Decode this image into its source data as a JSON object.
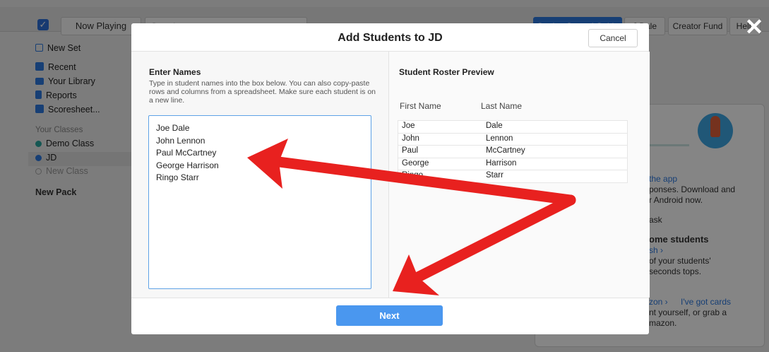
{
  "topbar": {
    "now_playing": "Now Playing",
    "search_placeholder": "Search",
    "guide": "Getting Started Guide",
    "user": "J Dale",
    "creator_fund": "Creator Fund",
    "help": "Help"
  },
  "sidebar": {
    "new_set": "New Set",
    "recent": "Recent",
    "library": "Your Library",
    "reports": "Reports",
    "scoresheet": "Scoresheet...",
    "classes_header": "Your Classes",
    "classes": [
      "Demo Class",
      "JD"
    ],
    "new_class": "New Class",
    "new_pack": "New Pack"
  },
  "background_card": {
    "link_app": "the app",
    "line1": "ponses. Download and",
    "line2": "r Android now.",
    "line3": "ask",
    "heading": "ome students",
    "link_sh": "sh ›",
    "line4": "of your students'",
    "line5": "seconds tops.",
    "link_amazon": "zon ›",
    "link_cards": "I've got cards",
    "line6": "nt yourself, or grab a",
    "line7": "mazon."
  },
  "modal": {
    "title": "Add Students to JD",
    "cancel": "Cancel",
    "enter_title": "Enter Names",
    "enter_help": "Type in student names into the box below. You can also copy-paste rows and columns from a spreadsheet. Make sure each student is on a new line.",
    "names": [
      "Joe Dale",
      "John Lennon",
      "Paul McCartney",
      "George Harrison",
      "Ringo Starr"
    ],
    "roster_title": "Student Roster Preview",
    "col_first": "First Name",
    "col_last": "Last Name",
    "roster": [
      {
        "first": "Joe",
        "last": "Dale"
      },
      {
        "first": "John",
        "last": "Lennon"
      },
      {
        "first": "Paul",
        "last": "McCartney"
      },
      {
        "first": "George",
        "last": "Harrison"
      },
      {
        "first": "Ringo",
        "last": "Starr"
      }
    ],
    "next": "Next"
  },
  "colors": {
    "accent": "#2c79e0",
    "next_button": "#4a97ef",
    "annotation_arrow": "#e8211f"
  },
  "icons": [
    "checkbox-logo-icon",
    "close-icon",
    "new-set-icon",
    "recent-icon",
    "folder-icon",
    "reports-icon",
    "scoresheet-icon",
    "class-dot-icon",
    "rocket-icon"
  ]
}
